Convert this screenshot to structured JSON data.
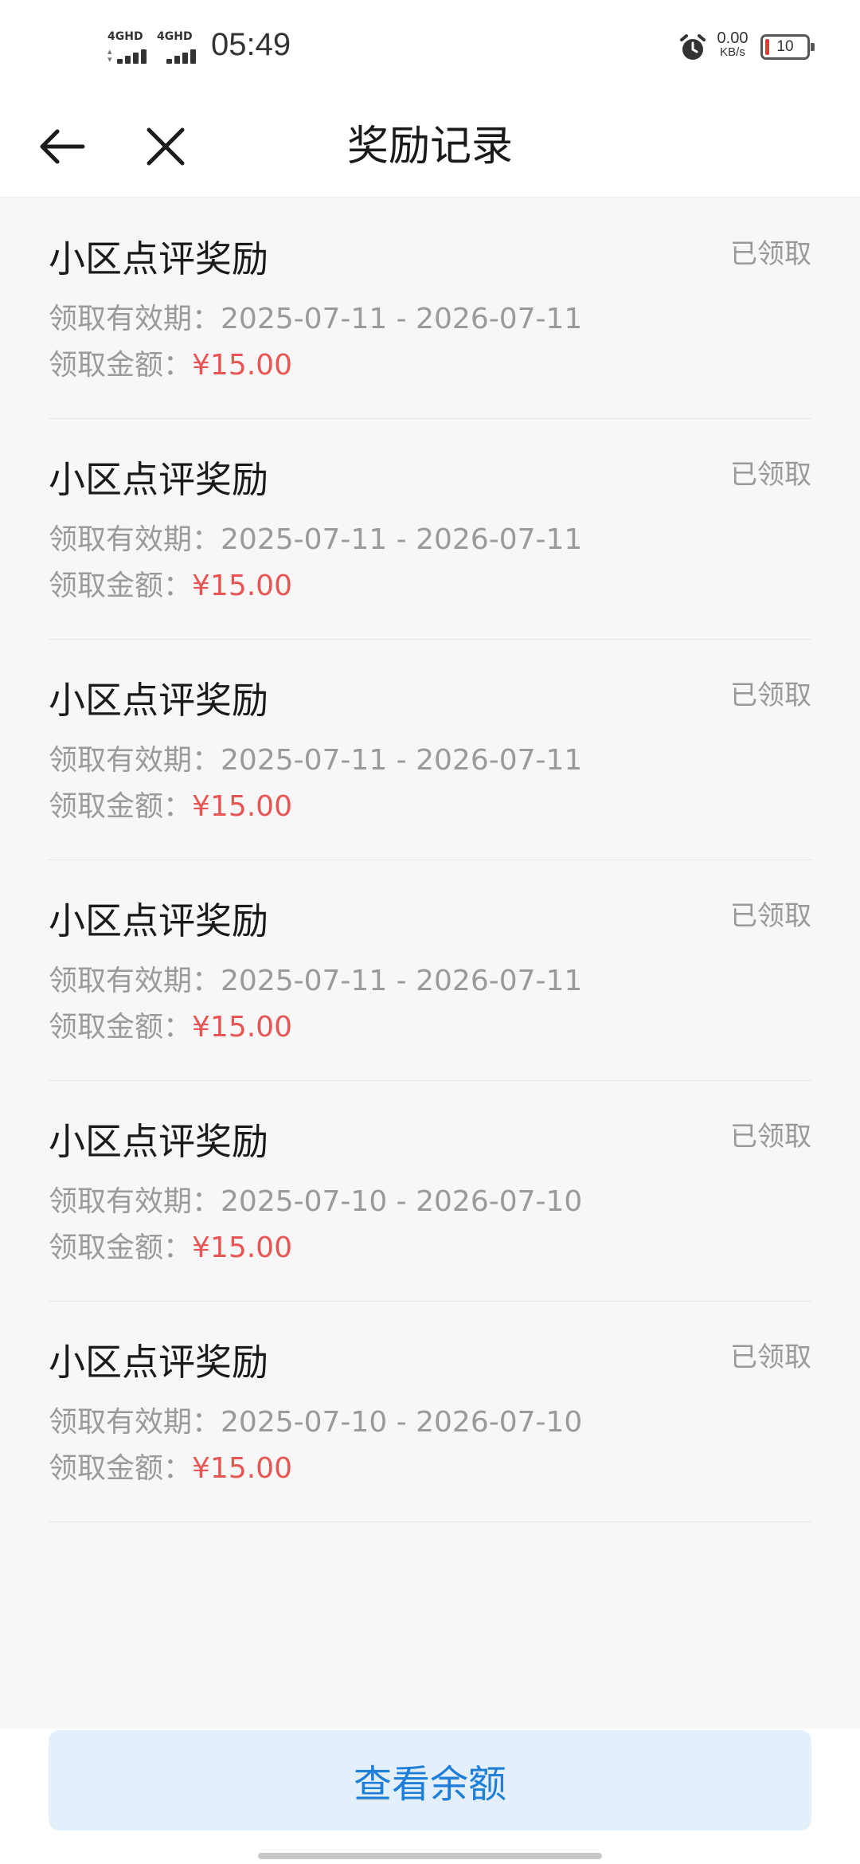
{
  "status_bar": {
    "network1": "4GHD",
    "network2": "4GHD",
    "time": "05:49",
    "net_speed_value": "0.00",
    "net_speed_unit": "KB/s",
    "battery_level": "10",
    "battery_color": "#e53935"
  },
  "header": {
    "title": "奖励记录",
    "back_icon": "arrow-left-icon",
    "close_icon": "close-icon"
  },
  "records": [
    {
      "name": "小区点评奖励",
      "status": "已领取",
      "period_label": "领取有效期：",
      "period": "2025-07-11 - 2026-07-11",
      "amount_label": "领取金额：",
      "amount": "¥15.00"
    },
    {
      "name": "小区点评奖励",
      "status": "已领取",
      "period_label": "领取有效期：",
      "period": "2025-07-11 - 2026-07-11",
      "amount_label": "领取金额：",
      "amount": "¥15.00"
    },
    {
      "name": "小区点评奖励",
      "status": "已领取",
      "period_label": "领取有效期：",
      "period": "2025-07-11 - 2026-07-11",
      "amount_label": "领取金额：",
      "amount": "¥15.00"
    },
    {
      "name": "小区点评奖励",
      "status": "已领取",
      "period_label": "领取有效期：",
      "period": "2025-07-11 - 2026-07-11",
      "amount_label": "领取金额：",
      "amount": "¥15.00"
    },
    {
      "name": "小区点评奖励",
      "status": "已领取",
      "period_label": "领取有效期：",
      "period": "2025-07-10 - 2026-07-10",
      "amount_label": "领取金额：",
      "amount": "¥15.00"
    },
    {
      "name": "小区点评奖励",
      "status": "已领取",
      "period_label": "领取有效期：",
      "period": "2025-07-10 - 2026-07-10",
      "amount_label": "领取金额：",
      "amount": "¥15.00"
    }
  ],
  "bottom": {
    "balance_button_label": "查看余额"
  },
  "colors": {
    "amount": "#e85555",
    "accent": "#1f7ed8",
    "button_bg": "#e3effb"
  }
}
